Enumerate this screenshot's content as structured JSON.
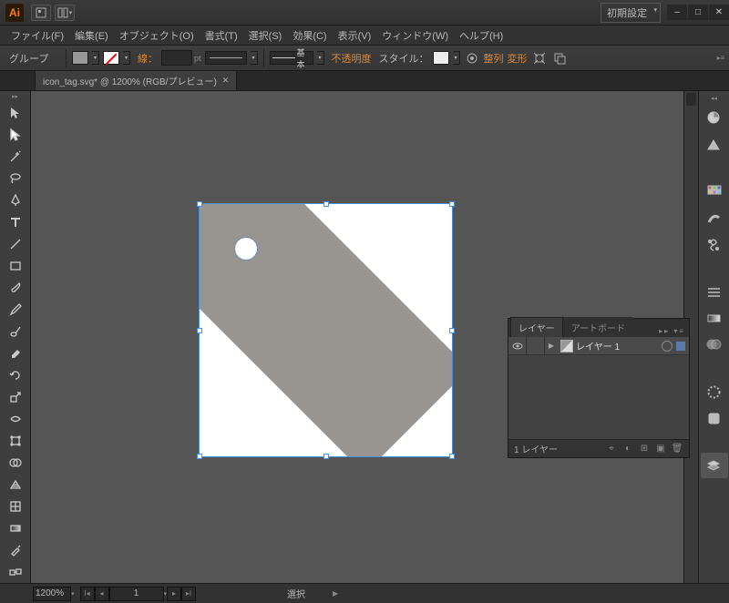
{
  "app": {
    "logo_text": "Ai",
    "workspace": "初期設定"
  },
  "menu": [
    "ファイル(F)",
    "編集(E)",
    "オブジェクト(O)",
    "書式(T)",
    "選択(S)",
    "効果(C)",
    "表示(V)",
    "ウィンドウ(W)",
    "ヘルプ(H)"
  ],
  "control": {
    "object_type": "グループ",
    "stroke_label": "線：",
    "stroke_pt": "pt",
    "brush_label": "基本",
    "opacity_label": "不透明度",
    "style_label": "スタイル：",
    "align_link": "整列",
    "transform_link": "変形"
  },
  "document": {
    "tab_title": "icon_tag.svg* @ 1200% (RGB/プレビュー)"
  },
  "layers_panel": {
    "tab_layers": "レイヤー",
    "tab_artboards": "アートボード",
    "layer1_name": "レイヤー 1",
    "footer_count": "1 レイヤー"
  },
  "status": {
    "zoom": "1200%",
    "artboard_num": "1",
    "current_tool": "選択"
  }
}
